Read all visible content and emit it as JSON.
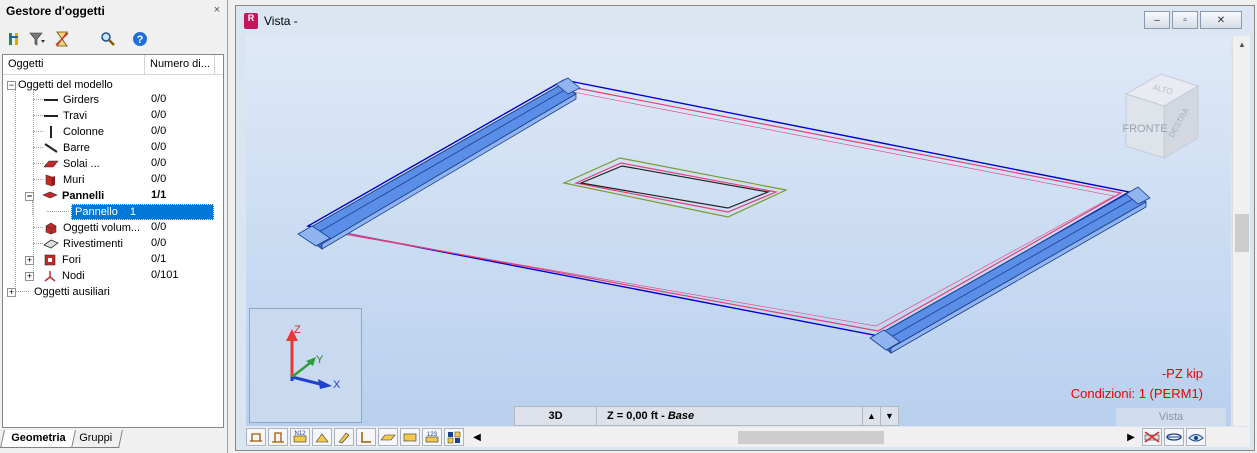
{
  "left_panel": {
    "title": "Gestore d'oggetti",
    "close": "×",
    "columns": {
      "objects": "Oggetti",
      "count": "Numero di..."
    },
    "tree": {
      "model_objects": {
        "label": "Oggetti del modello",
        "expander": "−"
      },
      "girders": {
        "label": "Girders",
        "count": "0/0"
      },
      "travi": {
        "label": "Travi",
        "count": "0/0"
      },
      "colonne": {
        "label": "Colonne",
        "count": "0/0"
      },
      "barre": {
        "label": "Barre",
        "count": "0/0"
      },
      "solai": {
        "label": "Solai ...",
        "count": "0/0"
      },
      "muri": {
        "label": "Muri",
        "count": "0/0"
      },
      "pannelli": {
        "label": "Pannelli",
        "count": "1/1",
        "expander": "−"
      },
      "pannello": {
        "label": "Pannello",
        "index": "1"
      },
      "oggetti_volumetrici": {
        "label": "Oggetti volum...",
        "count": "0/0"
      },
      "rivestimenti": {
        "label": "Rivestimenti",
        "count": "0/0"
      },
      "fori": {
        "label": "Fori",
        "count": "0/1",
        "expander": "+"
      },
      "nodi": {
        "label": "Nodi",
        "count": "0/101",
        "expander": "+"
      },
      "aux_objects": {
        "label": "Oggetti ausiliari",
        "expander": "+"
      }
    },
    "tabs": [
      "Geometria",
      "Gruppi"
    ]
  },
  "window": {
    "title": "Vista -",
    "app_icon": "R",
    "buttons": {
      "minimize": "–",
      "restore": "▫",
      "close": "✕"
    }
  },
  "viewport": {
    "view_cube": {
      "top": "ALTO",
      "front": "FRONTE",
      "right": "DESTRA"
    },
    "axes": {
      "x": "X",
      "y": "Y",
      "z": "Z"
    },
    "unit_info": "-PZ  kip",
    "conditions": "Condizioni: 1 (PERM1)",
    "status_3d": "3D",
    "status_level_prefix": "Z = 0,00 ft - ",
    "status_level_name": "Base",
    "vista_label": "Vista"
  },
  "colors": {
    "selection": "#0078d7",
    "slab_edge": "#0000cc",
    "panel_line": "#e0407a",
    "footing": "#5b8ee6",
    "info_red": "#e00000"
  }
}
